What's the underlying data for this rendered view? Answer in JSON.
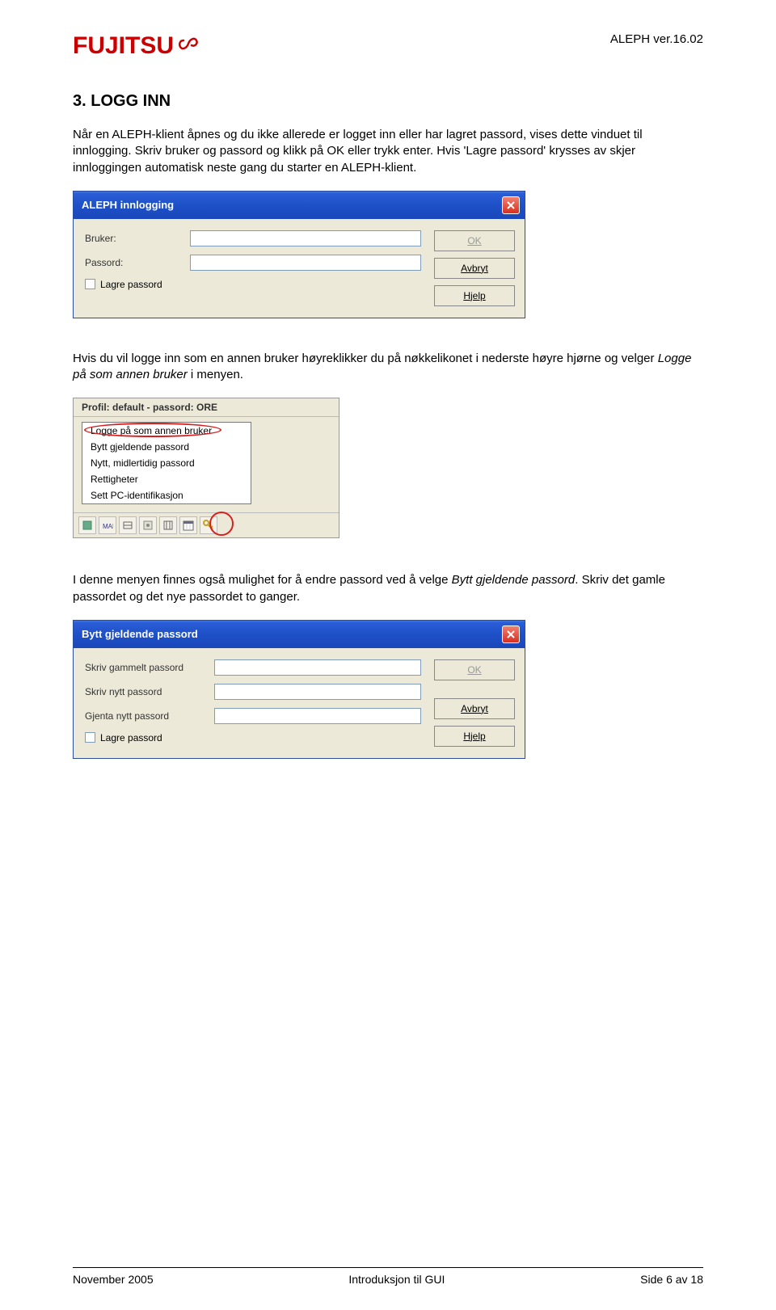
{
  "header": {
    "logo_text": "FUJITSU",
    "version": "ALEPH ver.16.02"
  },
  "section_title": "3. LOGG INN",
  "para1": "Når en ALEPH-klient åpnes og du ikke allerede er logget inn eller har lagret passord, vises dette vinduet til innlogging. Skriv bruker og passord og klikk på OK eller trykk enter. Hvis 'Lagre passord' krysses av skjer innloggingen automatisk neste gang du starter en ALEPH-klient.",
  "login_dialog": {
    "title": "ALEPH innlogging",
    "user_label": "Bruker:",
    "user_value": "",
    "password_label": "Passord:",
    "password_value": "",
    "save_label": "Lagre passord",
    "ok": "OK",
    "cancel": "Avbryt",
    "help": "Hjelp"
  },
  "para2_a": "Hvis du vil logge inn som en annen bruker høyreklikker du på nøkkelikonet i nederste høyre hjørne og velger ",
  "para2_b_italic": "Logge på som annen bruker",
  "para2_c": " i menyen.",
  "context": {
    "profile": "Profil: default - passord: ORE",
    "items": [
      "Logge på som annen bruker",
      "Bytt gjeldende passord",
      "Nytt, midlertidig passord",
      "Rettigheter",
      "Sett PC-identifikasjon"
    ]
  },
  "para3_a": "I denne menyen finnes også mulighet for å endre passord ved å velge ",
  "para3_b_italic": "Bytt gjeldende passord",
  "para3_c": ". Skriv det gamle passordet og det nye passordet to ganger.",
  "change_dialog": {
    "title": "Bytt gjeldende passord",
    "old_label": "Skriv gammelt passord",
    "new_label": "Skriv nytt passord",
    "repeat_label": "Gjenta nytt passord",
    "save_label": "Lagre passord",
    "ok": "OK",
    "cancel": "Avbryt",
    "help": "Hjelp"
  },
  "footer": {
    "left": "November 2005",
    "center": "Introduksjon til GUI",
    "right": "Side 6 av 18"
  }
}
